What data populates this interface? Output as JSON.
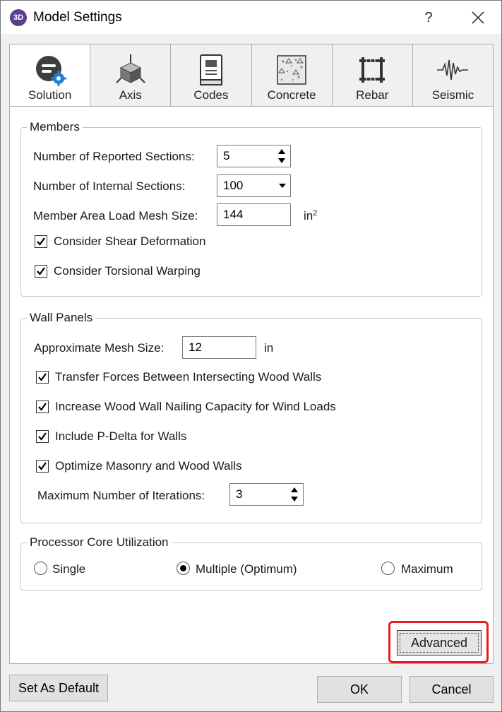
{
  "window": {
    "app_icon": "3D",
    "title": "Model Settings",
    "help": "?",
    "close_icon": "close-icon"
  },
  "tabs": [
    {
      "label": "Solution",
      "icon": "solution-gear-icon",
      "active": true
    },
    {
      "label": "Axis",
      "icon": "axis-cube-icon",
      "active": false
    },
    {
      "label": "Codes",
      "icon": "codes-book-icon",
      "active": false
    },
    {
      "label": "Concrete",
      "icon": "concrete-icon",
      "active": false
    },
    {
      "label": "Rebar",
      "icon": "rebar-icon",
      "active": false
    },
    {
      "label": "Seismic",
      "icon": "seismic-wave-icon",
      "active": false
    }
  ],
  "members": {
    "title": "Members",
    "reported_sections_label": "Number of Reported Sections:",
    "reported_sections_value": "5",
    "internal_sections_label": "Number of Internal Sections:",
    "internal_sections_value": "100",
    "mesh_size_label": "Member Area Load Mesh Size:",
    "mesh_size_value": "144",
    "mesh_size_unit": "in",
    "mesh_size_unit_sup": "2",
    "shear_label": "Consider Shear Deformation",
    "shear_checked": true,
    "torsional_label": "Consider Torsional Warping",
    "torsional_checked": true
  },
  "wall_panels": {
    "title": "Wall Panels",
    "mesh_label": "Approximate Mesh Size:",
    "mesh_value": "12",
    "mesh_unit": "in",
    "transfer_label": "Transfer Forces Between Intersecting Wood Walls",
    "increase_label": "Increase Wood Wall Nailing Capacity for Wind Loads",
    "pdelta_label": "Include P-Delta for Walls",
    "optimize_label": "Optimize Masonry and Wood Walls",
    "iterations_label": "Maximum Number of Iterations:",
    "iterations_value": "3"
  },
  "processor": {
    "title": "Processor Core Utilization",
    "single_label": "Single",
    "multiple_label": "Multiple (Optimum)",
    "maximum_label": "Maximum",
    "selected": "Multiple (Optimum)"
  },
  "buttons": {
    "advanced": "Advanced",
    "set_default": "Set As Default",
    "ok": "OK",
    "cancel": "Cancel"
  },
  "colors": {
    "highlight": "#e51c23",
    "app_icon_bg": "#5b3f8f",
    "gear_blue": "#1e7fd6"
  }
}
